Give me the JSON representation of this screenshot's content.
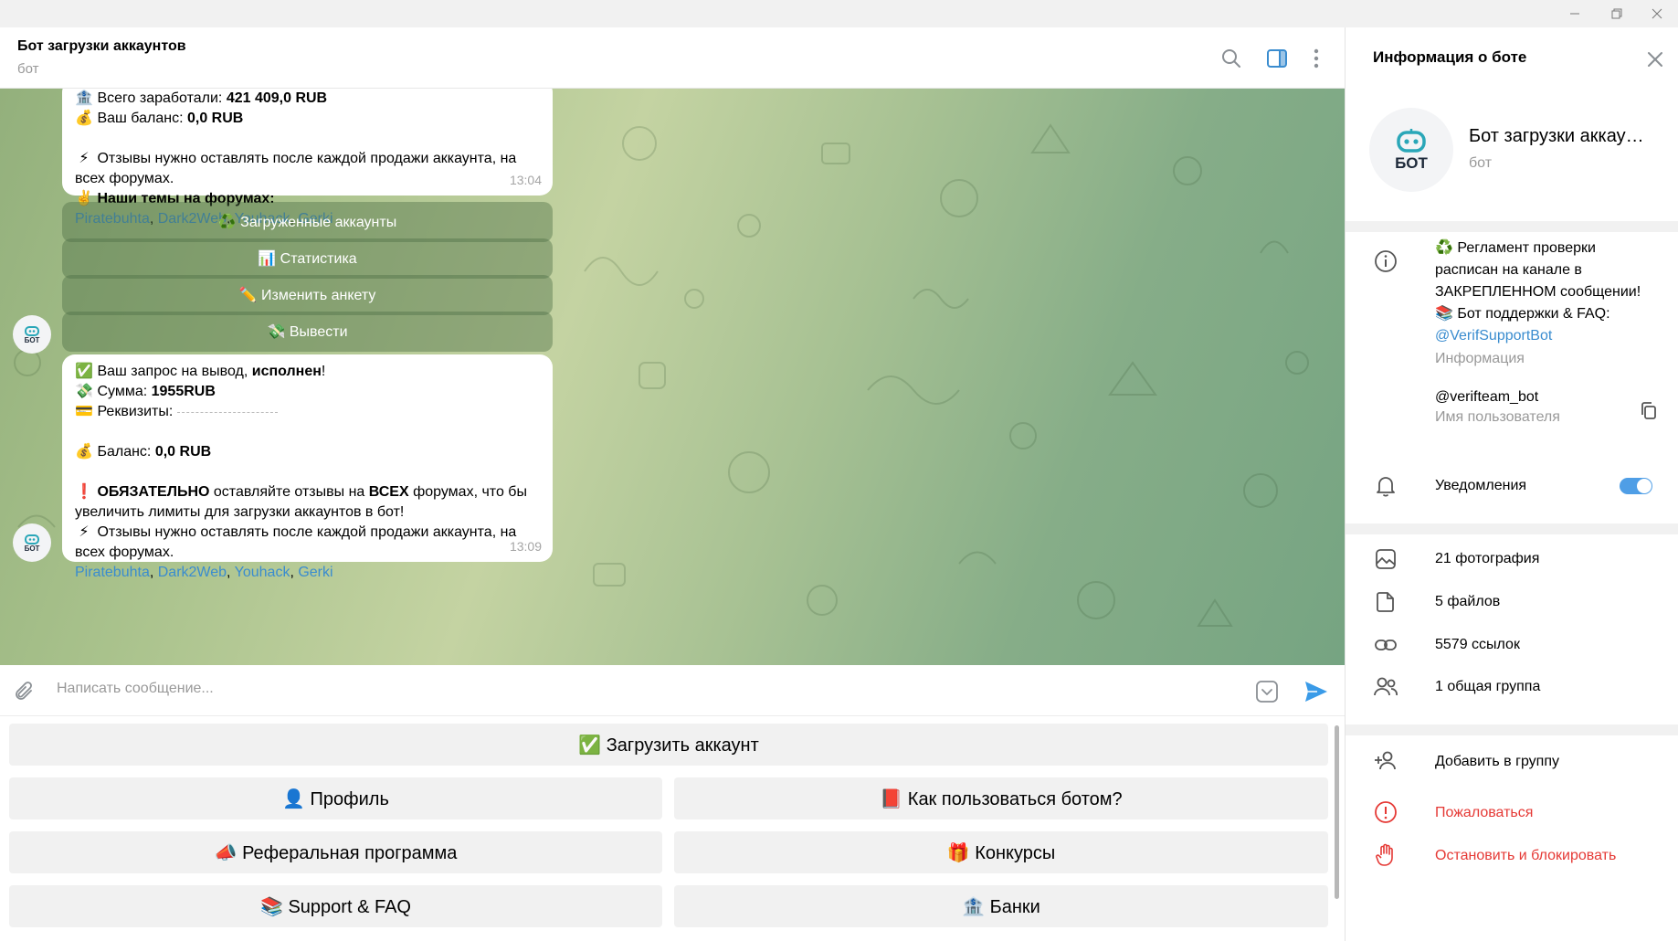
{
  "chat": {
    "title": "Бот загрузки аккаунтов",
    "subtitle": "бот"
  },
  "message1": {
    "earned_label": "Всего заработали:",
    "earned_value": "421 409,0 RUB",
    "balance_label": "Ваш баланс:",
    "balance_value": "0,0 RUB",
    "reviews_line1": "Отзывы нужно оставлять после каждой продажи аккаунта, на",
    "reviews_line2": "всех форумах.",
    "topics": "Наши темы на форумах:",
    "links": [
      "Piratebuhta",
      "Dark2Web",
      "Youhack",
      "Gerki"
    ],
    "time": "13:04"
  },
  "inline_buttons": [
    "♻️ Загруженные аккаунты",
    "📊 Статистика",
    "✏️ Изменить анкету",
    "💸 Вывести"
  ],
  "message2": {
    "request_prefix": "Ваш запрос на вывод,",
    "request_status": "исполнен",
    "sum_label": "Сумма:",
    "sum_value": "1955RUB",
    "requisites_label": "Реквизиты:",
    "balance_label": "Баланс:",
    "balance_value": "0,0 RUB",
    "must": "ОБЯЗАТЕЛЬНО",
    "must_text1": "оставляйте отзывы на",
    "must_all": "ВСЕХ",
    "must_text2": "форумах, что бы",
    "must_line2": "увеличить лимиты для загрузки аккаунтов в бот!",
    "reviews_line1": "Отзывы нужно оставлять после каждой продажи аккаунта, на",
    "reviews_line2": "всех форумах.",
    "links": [
      "Piratebuhta",
      "Dark2Web",
      "Youhack",
      "Gerki"
    ],
    "time": "13:09"
  },
  "input": {
    "placeholder": "Написать сообщение..."
  },
  "keyboard": [
    "✅ Загрузить аккаунт",
    "👤 Профиль",
    "📕 Как пользоваться ботом?",
    "📣 Реферальная программа",
    "🎁 Конкурсы",
    "📚 Support & FAQ",
    "🏦 Банки"
  ],
  "avatar_text": "БОТ",
  "panel": {
    "title": "Информация о боте",
    "bot_name": "Бот загрузки аккаунтов",
    "bot_type": "бот",
    "info_lines": [
      "♻️ Регламент проверки",
      "расписан на канале в",
      "ЗАКРЕПЛЕННОМ сообщении!",
      "📚 Бот поддержки & FAQ:"
    ],
    "support_link": "@VerifSupportBot",
    "info_label": "Информация",
    "username": "@verifteam_bot",
    "username_label": "Имя пользователя",
    "notifications": "Уведомления",
    "notifications_on": true,
    "photos": "21 фотография",
    "files": "5 файлов",
    "links": "5579 ссылок",
    "groups": "1 общая группа",
    "add_to_group": "Добавить в группу",
    "report": "Пожаловаться",
    "block": "Остановить и блокировать"
  },
  "colors": {
    "accent": "#3a8ccf",
    "danger": "#e53935",
    "toggle": "#4f9ee6"
  }
}
